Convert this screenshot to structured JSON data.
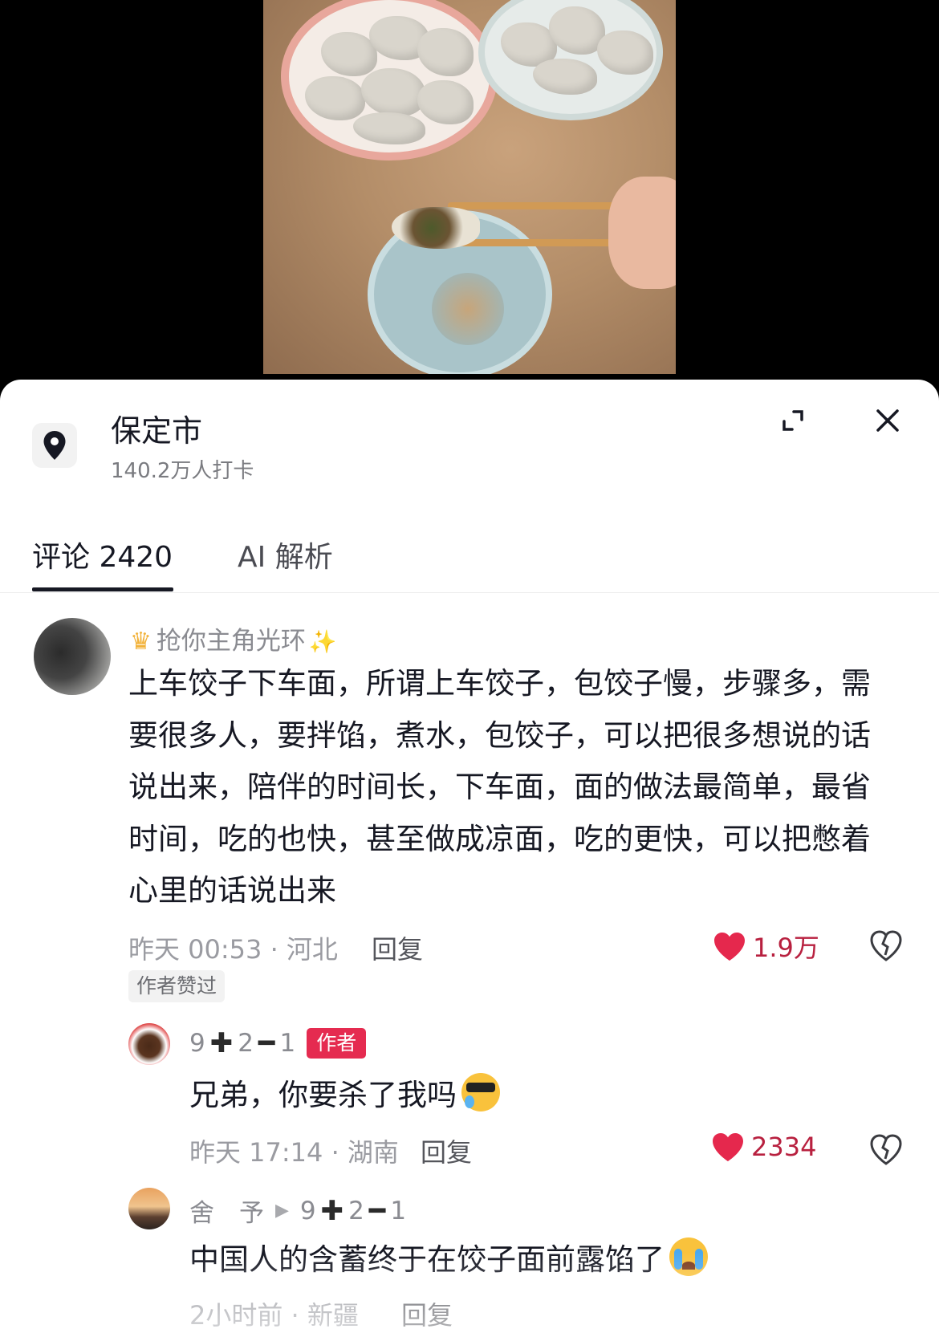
{
  "location": {
    "name": "保定市",
    "checkins": "140.2万人打卡"
  },
  "tabs": [
    {
      "label": "评论 2420",
      "active": true
    },
    {
      "label": "AI 解析",
      "active": false
    }
  ],
  "comments": [
    {
      "username": "抢你主角光环",
      "text": "上车饺子下车面，所谓上车饺子，包饺子慢，步骤多，需要很多人，要拌馅，煮水，包饺子，可以把很多想说的话说出来，陪伴的时间长，下车面，面的做法最简单，最省时间，吃的也快，甚至做成凉面，吃的更快，可以把憋着心里的话说出来",
      "meta": "昨天 00:53 · 河北",
      "reply_label": "回复",
      "likes": "1.9万",
      "badge": "作者赞过"
    }
  ],
  "replies": [
    {
      "name_parts": [
        "9",
        "2",
        "1"
      ],
      "author_badge": "作者",
      "text": "兄弟，你要杀了我吗",
      "meta": "昨天 17:14 · 湖南",
      "reply_label": "回复",
      "likes": "2334"
    },
    {
      "username": "舍　予",
      "target_parts": [
        "9",
        "2",
        "1"
      ],
      "text": "中国人的含蓄终于在饺子面前露馅了",
      "meta": "2小时前 · 新疆",
      "reply_label": "回复"
    }
  ],
  "colors": {
    "like_red": "#e5284d",
    "author_badge": "#e52b50"
  }
}
